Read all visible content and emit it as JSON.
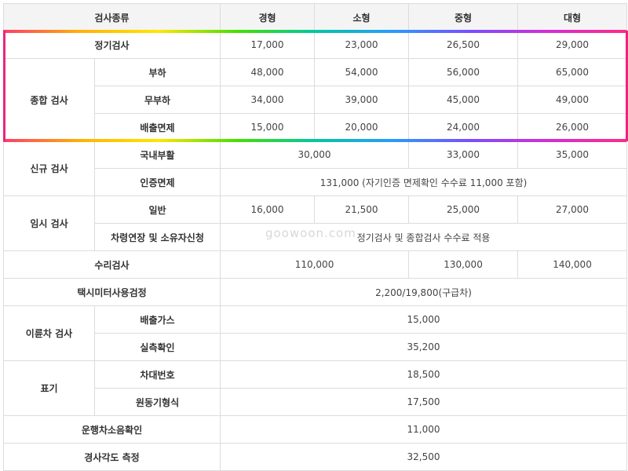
{
  "header": {
    "type_label": "검사종류",
    "size_light": "경형",
    "size_small": "소형",
    "size_medium": "중형",
    "size_large": "대형"
  },
  "rows": {
    "periodic": {
      "label": "정기검사",
      "v": [
        "17,000",
        "23,000",
        "26,500",
        "29,000"
      ]
    },
    "comprehensive": {
      "label": "종합 검사",
      "load": {
        "label": "부하",
        "v": [
          "48,000",
          "54,000",
          "56,000",
          "65,000"
        ]
      },
      "noload": {
        "label": "무부하",
        "v": [
          "34,000",
          "39,000",
          "45,000",
          "49,000"
        ]
      },
      "exempt": {
        "label": "배출면제",
        "v": [
          "15,000",
          "20,000",
          "24,000",
          "26,000"
        ]
      }
    },
    "new": {
      "label": "신규 검사",
      "domestic": {
        "label": "국내부활",
        "v_light_small": "30,000",
        "v_medium": "33,000",
        "v_large": "35,000"
      },
      "cert": {
        "label": "인증면제",
        "v": "131,000 (자기인증 면제확인 수수료 11,000 포함)"
      }
    },
    "temp": {
      "label": "임시 검사",
      "general": {
        "label": "일반",
        "v": [
          "16,000",
          "21,500",
          "25,000",
          "27,000"
        ]
      },
      "extension": {
        "label": "차령연장 및 소유자신청",
        "v": "정기검사 및 종합검사 수수료 적용"
      }
    },
    "repair": {
      "label": "수리검사",
      "v_light_small": "110,000",
      "v_medium": "130,000",
      "v_large": "140,000"
    },
    "taxi": {
      "label": "택시미터사용검정",
      "v": "2,200/19,800(구급차)"
    },
    "twowheel": {
      "label": "이륜차 검사",
      "exhaust": {
        "label": "배출가스",
        "v": "15,000"
      },
      "measure": {
        "label": "실측확인",
        "v": "35,200"
      }
    },
    "mark": {
      "label": "표기",
      "number": {
        "label": "차대번호",
        "v": "18,500"
      },
      "engine": {
        "label": "원동기형식",
        "v": "17,500"
      }
    },
    "noise": {
      "label": "운행차소음확인",
      "v": "11,000"
    },
    "slope": {
      "label": "경사각도 측정",
      "v": "32,500"
    }
  },
  "watermark": "goowoon.com",
  "colors": {
    "highlight_border": "#e8267e",
    "header_bg": "#f4f4f4",
    "grid": "#dcdcdc"
  }
}
